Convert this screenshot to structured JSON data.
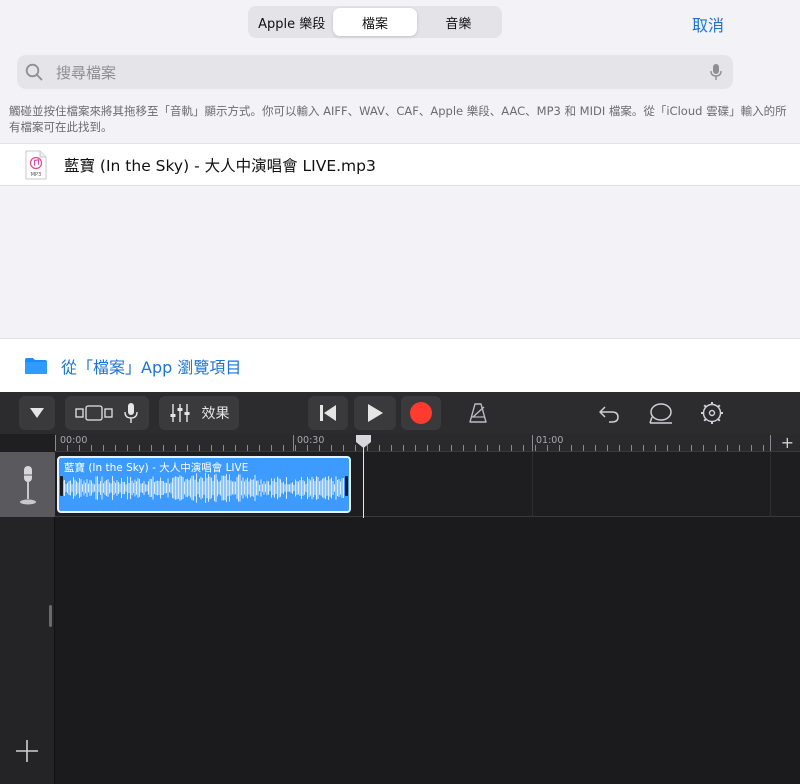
{
  "browser": {
    "tabs": [
      {
        "label": "Apple 樂段",
        "active": false
      },
      {
        "label": "檔案",
        "active": true
      },
      {
        "label": "音樂",
        "active": false
      }
    ],
    "cancel_label": "取消",
    "search_placeholder": "搜尋檔案",
    "hint_text": "觸碰並按住檔案來將其拖移至「音軌」顯示方式。你可以輸入 AIFF、WAV、CAF、Apple 樂段、AAC、MP3 和 MIDI 檔案。從「iCloud 雲碟」輸入的所有檔案可在此找到。",
    "file": {
      "name": "藍寶 (In the Sky) - 大人中演唱會 LIVE.mp3",
      "badge": "MP3"
    },
    "browse_label": "從「檔案」App 瀏覽項目"
  },
  "garageband": {
    "fx_label": "效果",
    "ruler_labels": [
      "00:00",
      "00:30",
      "01:00"
    ],
    "region_name": "藍寶 (In the Sky) - 大人中演唱會 LIVE",
    "colors": {
      "region": "#3d9bff",
      "record": "#ff3b30",
      "accent": "#1a73d9"
    }
  }
}
